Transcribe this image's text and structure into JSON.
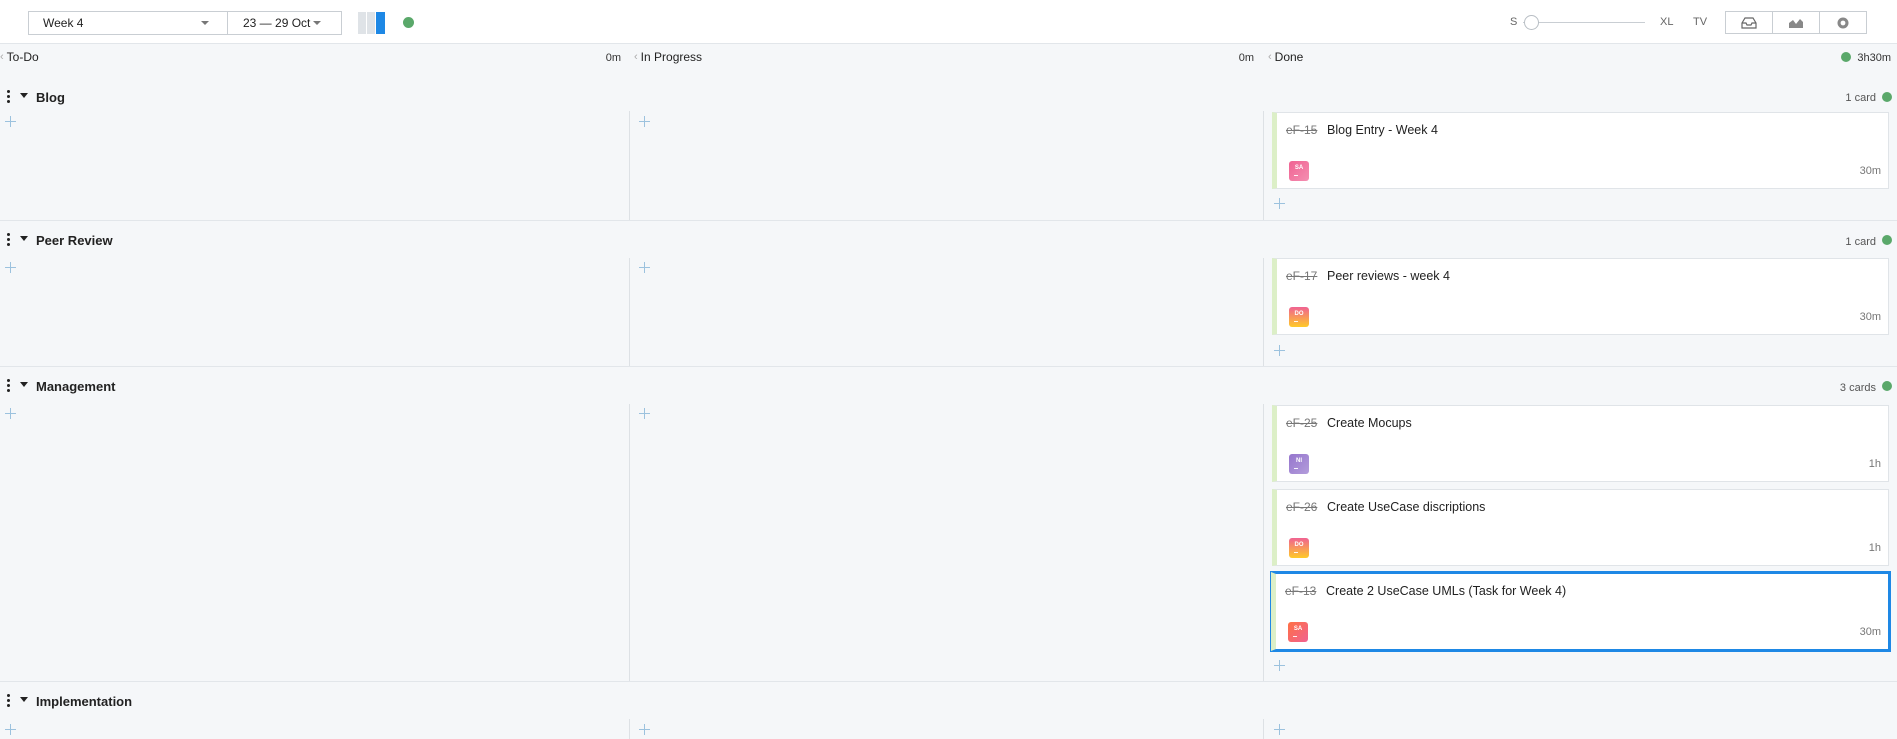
{
  "toolbar": {
    "week_select": "Week 4",
    "range_select": "23 — 29 Oct",
    "size_labels": {
      "s": "S",
      "xl": "XL",
      "tv": "TV"
    },
    "size_slider_value": "S",
    "view_buttons": [
      "inbox-icon",
      "chart-icon",
      "settings-icon"
    ]
  },
  "columns": [
    {
      "name": "To-Do",
      "time": "0m"
    },
    {
      "name": "In Progress",
      "time": "0m"
    },
    {
      "name": "Done",
      "time": "3h30m"
    }
  ],
  "lanes": [
    {
      "title": "Blog",
      "count": "1 card",
      "cards": [
        {
          "id": "eF-15",
          "title": "Blog Entry - Week 4",
          "avatar": "SA",
          "time": "30m",
          "selected": false
        }
      ]
    },
    {
      "title": "Peer Review",
      "count": "1 card",
      "cards": [
        {
          "id": "eF-17",
          "title": "Peer reviews - week 4",
          "avatar": "DO",
          "time": "30m",
          "selected": false
        }
      ]
    },
    {
      "title": "Management",
      "count": "3 cards",
      "cards": [
        {
          "id": "eF-25",
          "title": "Create Mocups",
          "avatar": "NI",
          "time": "1h",
          "selected": false
        },
        {
          "id": "eF-26",
          "title": "Create UseCase discriptions",
          "avatar": "DO",
          "time": "1h",
          "selected": false
        },
        {
          "id": "eF-13",
          "title": "Create 2 UseCase UMLs (Task for Week 4)",
          "avatar": "SA",
          "time": "30m",
          "selected": true
        }
      ]
    },
    {
      "title": "Implementation",
      "count": "",
      "cards": []
    }
  ],
  "colors": {
    "accent": "#1e88e5",
    "status_green": "#5aa86a",
    "done_bar": "#dcefc7"
  }
}
